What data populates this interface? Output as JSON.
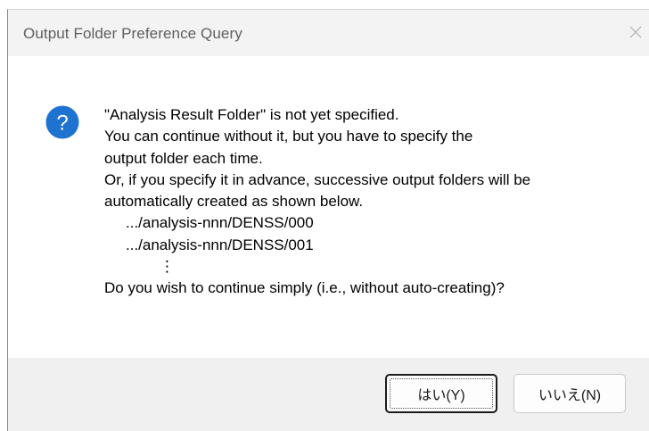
{
  "dialog": {
    "title": "Output Folder Preference Query",
    "icon": "question-icon",
    "accent_color": "#1e73d0",
    "message_lines": [
      "\"Analysis Result Folder\" is not yet specified.",
      "You can continue without it, but you have to specify the",
      "output folder each time.",
      "Or, if you specify it in advance, successive output folders will be",
      "automatically created as shown below."
    ],
    "example_paths": [
      ".../analysis-nnn/DENSS/000",
      ".../analysis-nnn/DENSS/001"
    ],
    "continuation": "⋮",
    "question": "Do you wish to continue simply (i.e., without auto-creating)?",
    "buttons": {
      "yes_label": "はい(Y)",
      "no_label": "いいえ(N)"
    }
  }
}
